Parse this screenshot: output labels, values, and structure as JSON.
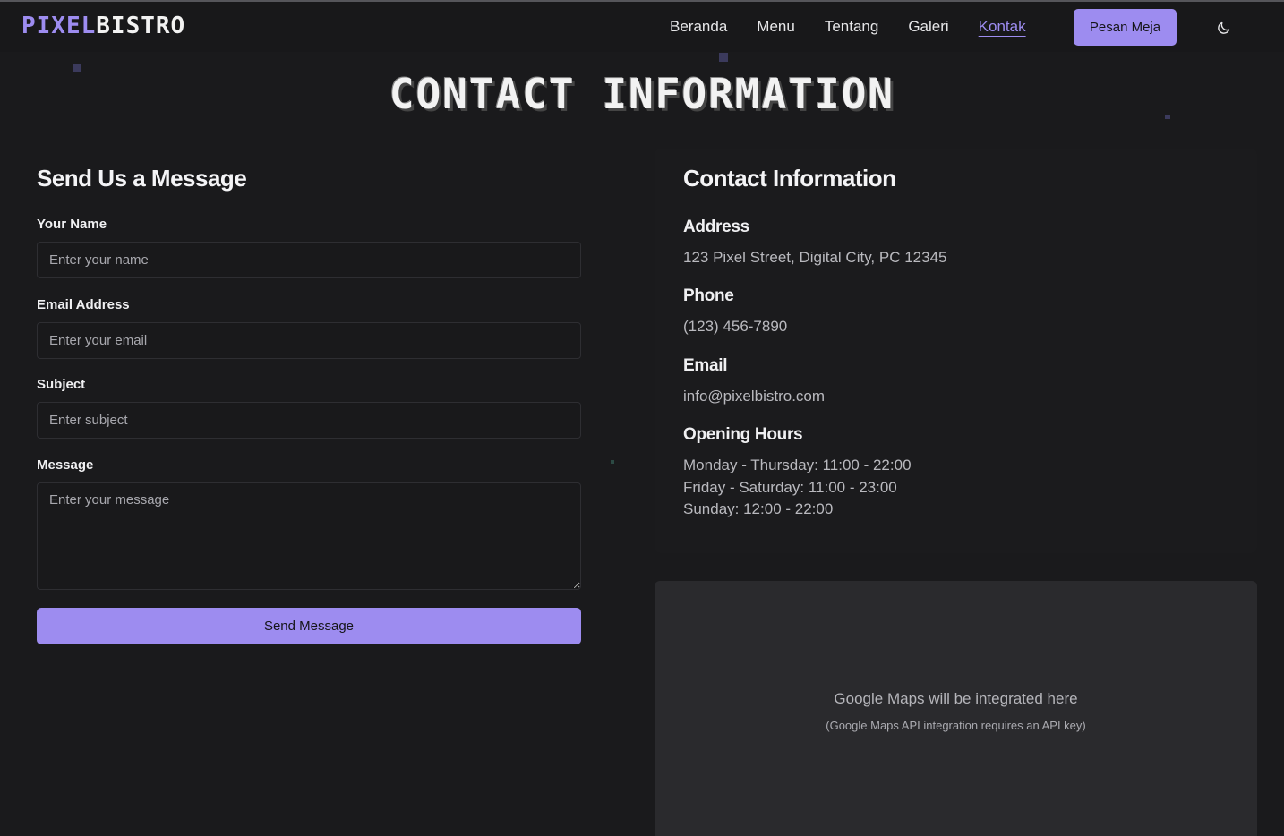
{
  "brand": {
    "part1": "PIXEL",
    "part2": "BISTRO"
  },
  "nav": {
    "items": [
      {
        "label": "Beranda"
      },
      {
        "label": "Menu"
      },
      {
        "label": "Tentang"
      },
      {
        "label": "Galeri"
      },
      {
        "label": "Kontak",
        "active": true
      }
    ],
    "cta_label": "Pesan Meja",
    "theme_toggle_icon": "moon-icon"
  },
  "page": {
    "title": "CONTACT INFORMATION"
  },
  "form": {
    "heading": "Send Us a Message",
    "name_label": "Your Name",
    "name_placeholder": "Enter your name",
    "email_label": "Email Address",
    "email_placeholder": "Enter your email",
    "subject_label": "Subject",
    "subject_placeholder": "Enter subject",
    "message_label": "Message",
    "message_placeholder": "Enter your message",
    "submit_label": "Send Message"
  },
  "contact": {
    "heading": "Contact Information",
    "address_label": "Address",
    "address_value": "123 Pixel Street, Digital City, PC 12345",
    "phone_label": "Phone",
    "phone_value": "(123) 456-7890",
    "email_label": "Email",
    "email_value": "info@pixelbistro.com",
    "hours_label": "Opening Hours",
    "hours": [
      "Monday - Thursday: 11:00 - 22:00",
      "Friday - Saturday: 11:00 - 23:00",
      "Sunday: 12:00 - 22:00"
    ]
  },
  "map": {
    "placeholder_text": "Google Maps will be integrated here",
    "note": "(Google Maps API integration requires an API key)"
  },
  "colors": {
    "accent": "#9d8cf0",
    "background": "#1a1a1c",
    "card": "#1b1b1d",
    "map_bg": "#2a2a2d"
  }
}
